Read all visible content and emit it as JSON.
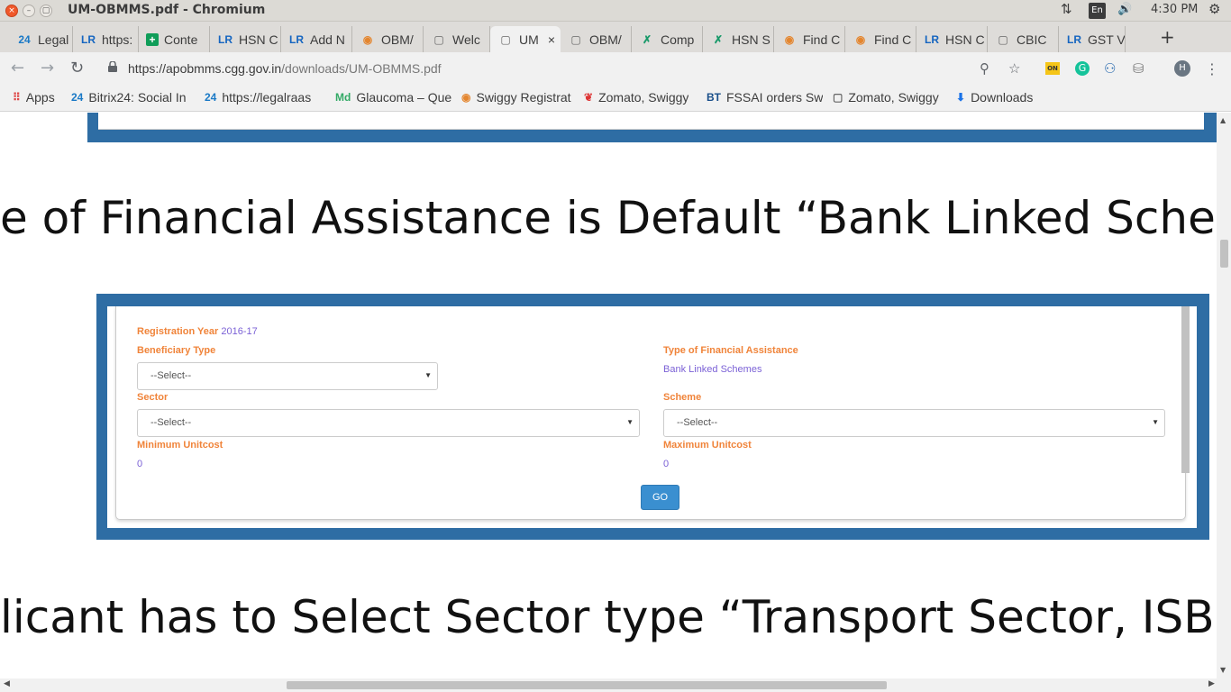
{
  "os": {
    "title": "UM-OBMMS.pdf - Chromium",
    "close_glyph": "×",
    "min_glyph": "–",
    "max_glyph": "▢",
    "lang": "En",
    "clock": "4:30 PM",
    "net_glyph": "⇅",
    "vol_glyph": "🔊",
    "gear_glyph": "⚙"
  },
  "tabs": [
    {
      "icon": "24",
      "label": "Legal",
      "icon_class": "fav-24",
      "width": 71
    },
    {
      "icon": "LR",
      "label": "https:",
      "icon_class": "fav-lr",
      "width": 73
    },
    {
      "icon": "+",
      "label": "Conte",
      "icon_class": "fav-green",
      "width": 79
    },
    {
      "icon": "LR",
      "label": "HSN C",
      "icon_class": "fav-lr",
      "width": 79
    },
    {
      "icon": "LR",
      "label": "Add N",
      "icon_class": "fav-lr",
      "width": 79
    },
    {
      "icon": "◉",
      "label": "OBM/",
      "icon_class": "fav-circle",
      "width": 79
    },
    {
      "icon": "▢",
      "label": "Welc",
      "icon_class": "fav-doc",
      "width": 74
    },
    {
      "icon": "▢",
      "label": "UM",
      "icon_class": "fav-doc",
      "width": 78,
      "active": true
    },
    {
      "icon": "▢",
      "label": "OBM/",
      "icon_class": "fav-doc",
      "width": 79
    },
    {
      "icon": "✗",
      "label": "Comp",
      "icon_class": "fav-run",
      "width": 79
    },
    {
      "icon": "✗",
      "label": "HSN S",
      "icon_class": "fav-run",
      "width": 79
    },
    {
      "icon": "◉",
      "label": "Find C",
      "icon_class": "fav-circle",
      "width": 79
    },
    {
      "icon": "◉",
      "label": "Find C",
      "icon_class": "fav-circle",
      "width": 79
    },
    {
      "icon": "LR",
      "label": "HSN C",
      "icon_class": "fav-lr",
      "width": 79
    },
    {
      "icon": "▢",
      "label": "CBIC",
      "icon_class": "fav-doc",
      "width": 79
    },
    {
      "icon": "LR",
      "label": "GST V",
      "icon_class": "fav-lr",
      "width": 74
    }
  ],
  "tab_close_glyph": "×",
  "new_tab_glyph": "+",
  "toolbar": {
    "back_glyph": "←",
    "fwd_glyph": "→",
    "reload_glyph": "↻",
    "url_host": "https://apobmms.cgg.gov.in",
    "url_path": "/downloads/UM-OBMMS.pdf",
    "zoom_glyph": "⚲",
    "star_glyph": "☆",
    "ext_on": "ON",
    "ext_g": "G",
    "ext_person_glyph": "⚇",
    "ext_db_glyph": "⛁",
    "avatar": "H",
    "menu_glyph": "⋮"
  },
  "bookmarks": [
    {
      "icon": "⠿",
      "label": "Apps",
      "width": 65
    },
    {
      "icon": "24",
      "label": "Bitrix24: Social In",
      "width": 148
    },
    {
      "icon": "24",
      "label": "https://legalraas",
      "width": 145
    },
    {
      "icon": "Md",
      "label": "Glaucoma – Que",
      "width": 140
    },
    {
      "icon": "◉",
      "label": "Swiggy Registrat",
      "width": 136
    },
    {
      "icon": "❦",
      "label": "Zomato, Swiggy",
      "width": 136
    },
    {
      "icon": "BT",
      "label": "FSSAI orders Sw",
      "width": 140
    },
    {
      "icon": "▢",
      "label": "Zomato, Swiggy",
      "width": 137
    },
    {
      "icon": "⬇",
      "label": "Downloads",
      "width": 105
    }
  ],
  "document": {
    "line1": "e of Financial Assistance is Default “Bank Linked Scheme",
    "line2": "licant has to Select Sector type “Transport Sector, ISB,"
  },
  "form": {
    "reg_year_label": "Registration Year",
    "reg_year_value": "2016-17",
    "beneficiary_label": "Beneficiary Type",
    "beneficiary_value": "--Select--",
    "fin_type_label": "Type of Financial Assistance",
    "fin_type_value": "Bank Linked Schemes",
    "sector_label": "Sector",
    "sector_value": "--Select--",
    "scheme_label": "Scheme",
    "scheme_value": "--Select--",
    "min_label": "Minimum Unitcost",
    "min_value": "0",
    "max_label": "Maximum Unitcost",
    "max_value": "0",
    "go_label": "GO",
    "caret_glyph": "▼"
  },
  "scroll": {
    "up": "▲",
    "down": "▼",
    "left": "◀",
    "right": "▶"
  }
}
